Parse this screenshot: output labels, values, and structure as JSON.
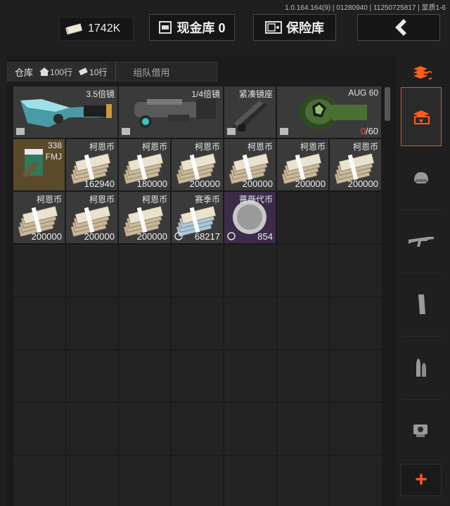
{
  "version": "1.0.164.164(9) | 01280940 | 11250725817 | 显质1-6",
  "header": {
    "money": "1742K",
    "cash_vault_label": "现金库 0",
    "safe_label": "保险库"
  },
  "tabs": {
    "warehouse": "仓库",
    "rows_home": "100行",
    "rows_extra": "10行",
    "team_borrow": "组队借用"
  },
  "items": [
    {
      "name": "3.5倍镜",
      "count": ""
    },
    {
      "name": "1/4倍镜",
      "count": ""
    },
    {
      "name": "紧凑镜座",
      "count": ""
    },
    {
      "name": "AUG 60",
      "count_red": "0",
      "count": "/60"
    },
    {
      "name": "338",
      "sub": "FMJ",
      "count": ""
    },
    {
      "name": "柯恩币",
      "count": "162940"
    },
    {
      "name": "柯恩币",
      "count": "180000"
    },
    {
      "name": "柯恩币",
      "count": "200000"
    },
    {
      "name": "柯恩币",
      "count": "200000"
    },
    {
      "name": "柯恩币",
      "count": "200000"
    },
    {
      "name": "柯恩币",
      "count": "200000"
    },
    {
      "name": "柯恩币",
      "count": "200000"
    },
    {
      "name": "柯恩币",
      "count": "200000"
    },
    {
      "name": "柯恩币",
      "count": "200000"
    },
    {
      "name": "赛季币",
      "count": "68217"
    },
    {
      "name": "蔷薇代币",
      "count": "854"
    }
  ],
  "colors": {
    "accent": "#e5531c",
    "money_bundle": "#c9b89a",
    "purple_rarity": "#3c2c4a",
    "gold_rarity": "#5a4a2a"
  },
  "sidebar": [
    "all-items-icon",
    "warehouse-icon",
    "helmet-icon",
    "rifle-icon",
    "magazine-icon",
    "ammo-icon",
    "scope-icon"
  ]
}
